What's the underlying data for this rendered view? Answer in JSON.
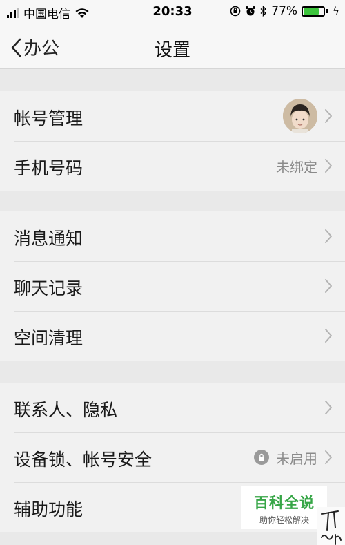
{
  "status_bar": {
    "carrier": "中国电信",
    "time": "20:33",
    "battery_percent": "77%",
    "battery_level": 0.77
  },
  "nav": {
    "back_label": "办公",
    "title": "设置"
  },
  "groups": [
    {
      "items": [
        {
          "label": "帐号管理",
          "value": "",
          "has_avatar": true
        },
        {
          "label": "手机号码",
          "value": "未绑定"
        }
      ]
    },
    {
      "items": [
        {
          "label": "消息通知",
          "value": ""
        },
        {
          "label": "聊天记录",
          "value": ""
        },
        {
          "label": "空间清理",
          "value": ""
        }
      ]
    },
    {
      "items": [
        {
          "label": "联系人、隐私",
          "value": ""
        },
        {
          "label": "设备锁、帐号安全",
          "value": "未启用",
          "icon": "lock-icon"
        },
        {
          "label": "辅助功能",
          "value": ""
        }
      ]
    }
  ],
  "watermark": {
    "title": "百科全说",
    "subtitle": "助你轻松解决"
  },
  "colors": {
    "accent_green": "#37a647",
    "battery_green": "#3cc43c"
  }
}
